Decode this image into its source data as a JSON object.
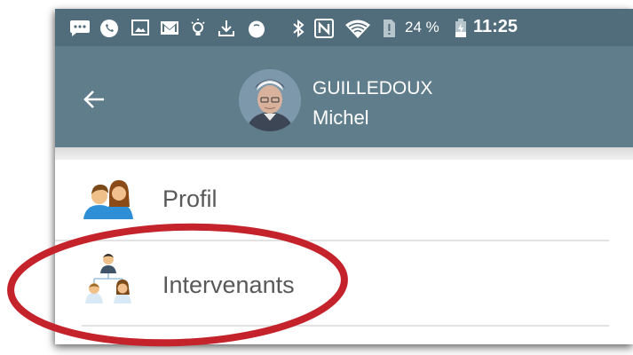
{
  "status_bar": {
    "battery_percent": "24 %",
    "clock": "11:25",
    "icons": [
      "message-icon",
      "whatsapp-icon",
      "gallery-icon",
      "gmail-icon",
      "bulb-icon",
      "download-icon",
      "egg-icon",
      "bluetooth-icon",
      "nfc-icon",
      "wifi-icon",
      "sim-alert-icon",
      "battery-charging-icon"
    ]
  },
  "header": {
    "last_name": "GUILLEDOUX",
    "first_name": "Michel"
  },
  "menu": {
    "items": [
      {
        "label": "Profil",
        "icon": "profile-people-icon"
      },
      {
        "label": "Intervenants",
        "icon": "team-hierarchy-icon"
      }
    ]
  },
  "colors": {
    "status_bar": "#516c7b",
    "app_bar": "#607d8b",
    "label_text": "#595959",
    "highlight_ring": "#c4232b"
  }
}
